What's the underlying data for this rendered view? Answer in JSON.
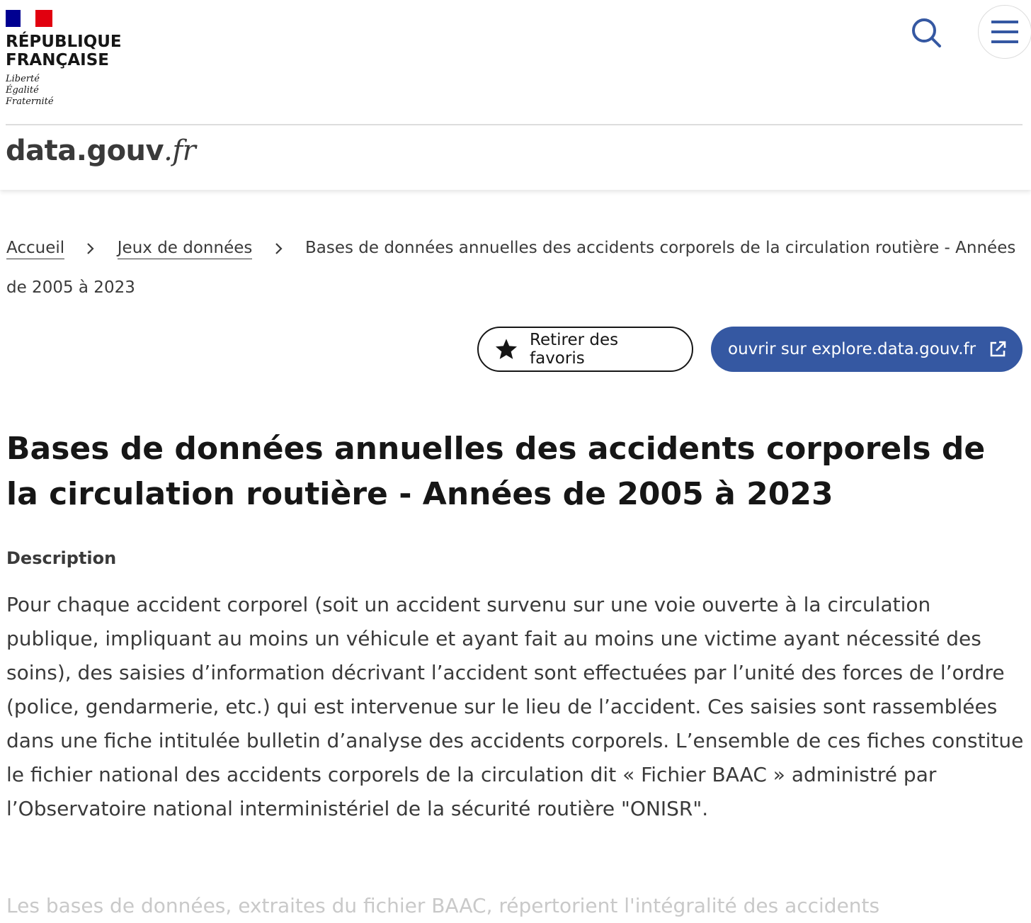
{
  "header": {
    "republic_line1": "RÉPUBLIQUE",
    "republic_line2": "FRANÇAISE",
    "motto": [
      "Liberté",
      "Égalité",
      "Fraternité"
    ],
    "brand_main": "data.gouv",
    "brand_suffix": ".fr",
    "search_icon": "search-icon",
    "menu_icon": "hamburger-menu-icon"
  },
  "breadcrumb": {
    "items": [
      "Accueil",
      "Jeux de données"
    ],
    "current": "Bases de données annuelles des accidents corporels de la circulation routière - Années de 2005 à 2023"
  },
  "actions": {
    "favorite_label": "Retirer des favoris",
    "explore_label": "ouvrir sur explore.data.gouv.fr"
  },
  "page": {
    "title": "Bases de données annuelles des accidents corporels de la circulation routière - Années de 2005 à 2023",
    "description_label": "Description",
    "description": "Pour chaque accident corporel (soit un accident survenu sur une voie ouverte à la circulation publique, impliquant au moins un véhicule et ayant fait au moins une victime ayant nécessité des soins), des saisies d’information décrivant l’accident sont effectuées par l’unité des forces de l’ordre (police, gendarmerie, etc.) qui est intervenue sur le lieu de l’accident. Ces saisies sont rassemblées dans une fiche intitulée bulletin d’analyse des accidents corporels. L’ensemble de ces fiches constitue le fichier national des accidents corporels de la circulation dit « Fichier BAAC » administré par l’Observatoire national interministériel de la sécurité routière \"ONISR\".",
    "description_more": "Les bases de données, extraites du fichier BAAC, répertorient l'intégralité des accidents"
  },
  "colors": {
    "accent": "#3558a2",
    "flag_blue": "#000091",
    "flag_red": "#e1000f"
  }
}
